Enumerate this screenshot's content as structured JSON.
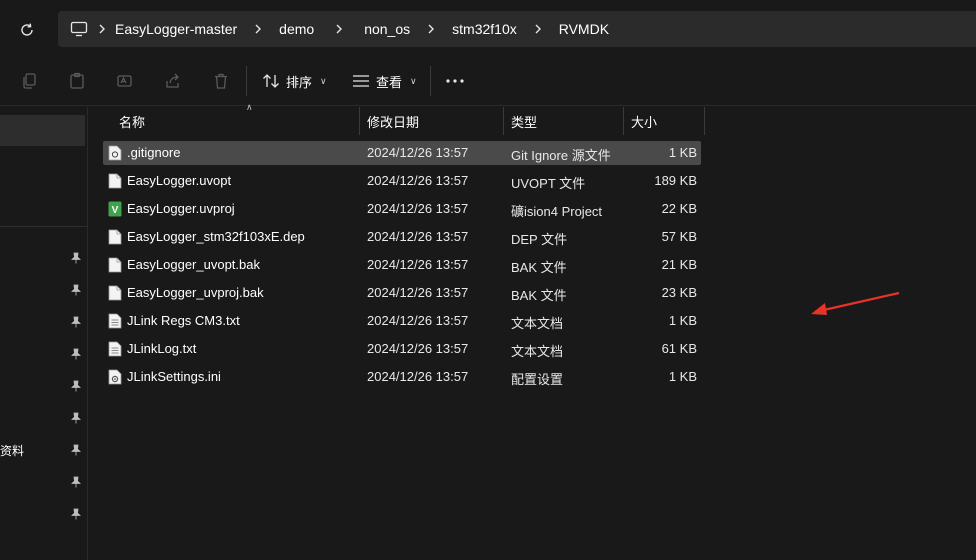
{
  "addressbar": {
    "crumbs": [
      "EasyLogger-master",
      "demo",
      "non_os",
      "stm32f10x",
      "RVMDK"
    ]
  },
  "toolbar": {
    "sort_label": "排序",
    "view_label": "查看"
  },
  "nav": {
    "partial_label": "资料"
  },
  "columns": {
    "name": "名称",
    "date": "修改日期",
    "type": "类型",
    "size": "大小"
  },
  "files": [
    {
      "name": ".gitignore",
      "date": "2024/12/26 13:57",
      "type": "Git Ignore 源文件",
      "size": "1 KB",
      "icon": "gitignore-file-icon"
    },
    {
      "name": "EasyLogger.uvopt",
      "date": "2024/12/26 13:57",
      "type": "UVOPT 文件",
      "size": "189 KB",
      "icon": "file-icon"
    },
    {
      "name": "EasyLogger.uvproj",
      "date": "2024/12/26 13:57",
      "type": "礦ision4 Project",
      "size": "22 KB",
      "icon": "keil-project-icon"
    },
    {
      "name": "EasyLogger_stm32f103xE.dep",
      "date": "2024/12/26 13:57",
      "type": "DEP 文件",
      "size": "57 KB",
      "icon": "file-icon"
    },
    {
      "name": "EasyLogger_uvopt.bak",
      "date": "2024/12/26 13:57",
      "type": "BAK 文件",
      "size": "21 KB",
      "icon": "file-icon"
    },
    {
      "name": "EasyLogger_uvproj.bak",
      "date": "2024/12/26 13:57",
      "type": "BAK 文件",
      "size": "23 KB",
      "icon": "file-icon"
    },
    {
      "name": "JLink Regs CM3.txt",
      "date": "2024/12/26 13:57",
      "type": "文本文档",
      "size": "1 KB",
      "icon": "text-file-icon"
    },
    {
      "name": "JLinkLog.txt",
      "date": "2024/12/26 13:57",
      "type": "文本文档",
      "size": "61 KB",
      "icon": "text-file-icon"
    },
    {
      "name": "JLinkSettings.ini",
      "date": "2024/12/26 13:57",
      "type": "配置设置",
      "size": "1 KB",
      "icon": "settings-file-icon"
    }
  ],
  "colors": {
    "background": "#191919",
    "selected_row": "#4a4a4a",
    "annotation_arrow": "#e8332a"
  }
}
